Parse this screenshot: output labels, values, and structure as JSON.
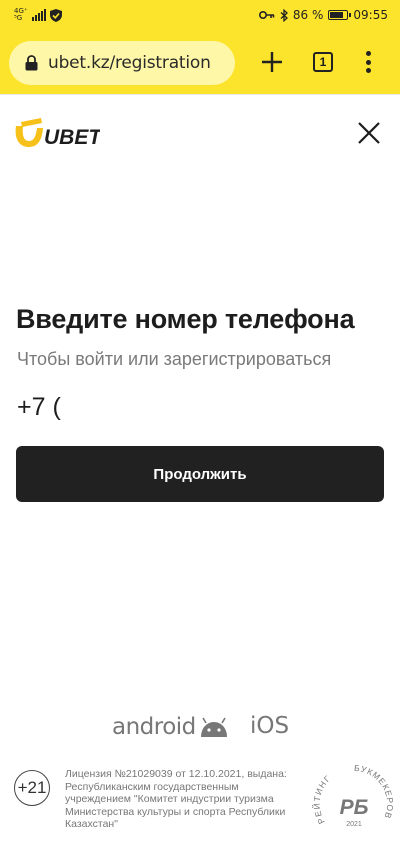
{
  "status_bar": {
    "network": "4G⁺",
    "network_sub": "⁵G",
    "battery_percent": "86 %",
    "battery_level": 0.86,
    "time": "09:55",
    "icons": [
      "signal-icon",
      "shield-check-icon",
      "key-icon",
      "bluetooth-icon",
      "battery-icon"
    ]
  },
  "browser": {
    "url": "ubet.kz/registration",
    "tab_count": "1",
    "accent": "#fde42c"
  },
  "header": {
    "logo_text": "UBET"
  },
  "main": {
    "title": "Введите номер телефона",
    "subtitle": "Чтобы войти или зарегистрироваться",
    "phone_value": "+7 (",
    "continue_label": "Продолжить"
  },
  "footer": {
    "android_label": "android",
    "ios_label": "iOS",
    "age_limit": "+21",
    "license": "Лицензия №21029039 от 12.10.2021, выдана: Республиканским государственным учреждением \"Комитет индустрии туризма Министерства культуры и спорта Республики Казахстан\"",
    "rating_badge": {
      "top_text": "РЕЙТИНГ",
      "right_text": "БУКМЕКЕРОВ",
      "logo": "РБ",
      "year": "2021"
    }
  }
}
